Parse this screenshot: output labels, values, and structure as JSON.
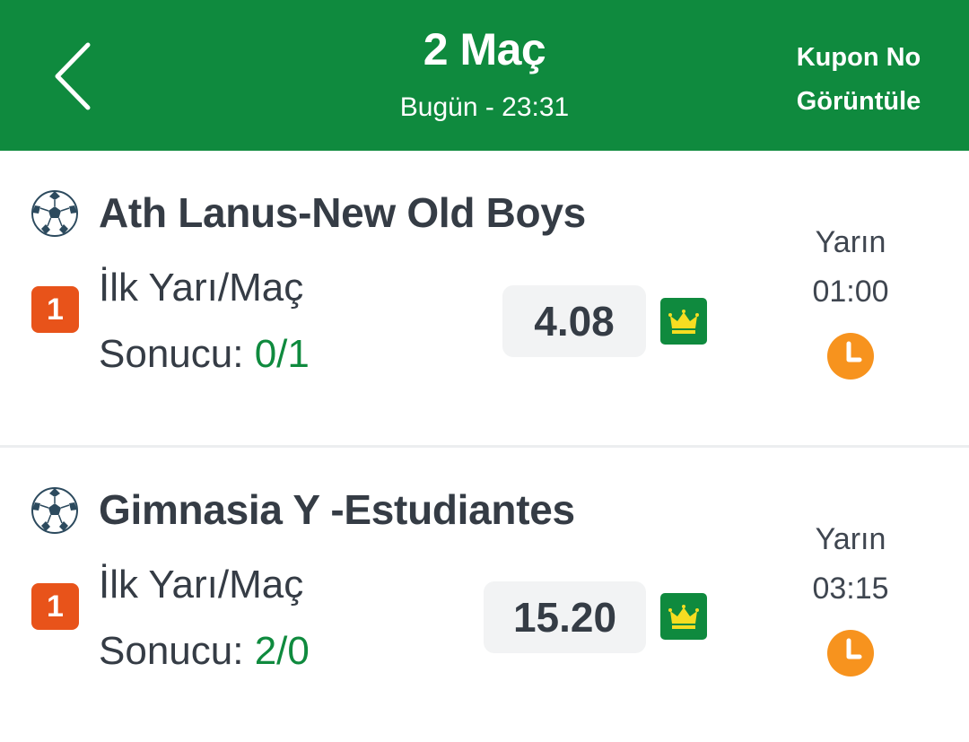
{
  "header": {
    "title": "2 Maç",
    "subtitle": "Bugün - 23:31",
    "kupon_line1": "Kupon No",
    "kupon_line2": "Görüntüle",
    "back_icon": "chevron-left-icon"
  },
  "colors": {
    "brand_green": "#0f8a3e",
    "pick_orange": "#e8531a",
    "clock_orange": "#f7931e",
    "text_dark": "#353c45"
  },
  "matches": [
    {
      "teams": "Ath Lanus-New Old Boys",
      "pick_number": "1",
      "market_line1": "İlk Yarı/Maç",
      "market_line2": "Sonucu: ",
      "selection": "0/1",
      "odds": "4.08",
      "day": "Yarın",
      "time": "01:00",
      "sport_icon": "soccer-ball-icon",
      "badge_icon": "crown-icon",
      "status_icon": "clock-icon"
    },
    {
      "teams": "Gimnasia Y -Estudiantes",
      "pick_number": "1",
      "market_line1": "İlk Yarı/Maç",
      "market_line2": "Sonucu: ",
      "selection": "2/0",
      "odds": "15.20",
      "day": "Yarın",
      "time": "03:15",
      "sport_icon": "soccer-ball-icon",
      "badge_icon": "crown-icon",
      "status_icon": "clock-icon"
    }
  ]
}
